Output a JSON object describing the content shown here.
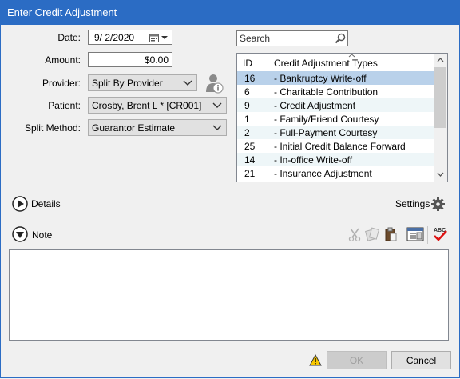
{
  "window": {
    "title": "Enter Credit Adjustment"
  },
  "form": {
    "date_label": "Date:",
    "date_value": "9/  2/2020",
    "amount_label": "Amount:",
    "amount_value": "$0.00",
    "provider_label": "Provider:",
    "provider_value": "Split By Provider",
    "patient_label": "Patient:",
    "patient_value": "Crosby, Brent L *  [CR001]",
    "split_label": "Split Method:",
    "split_value": "Guarantor Estimate"
  },
  "search": {
    "placeholder": "Search"
  },
  "types_list": {
    "col_id": "ID",
    "col_name": "Credit Adjustment Types",
    "rows": [
      {
        "id": "16",
        "name": "- Bankruptcy Write-off"
      },
      {
        "id": "6",
        "name": "- Charitable Contribution"
      },
      {
        "id": "9",
        "name": "- Credit Adjustment"
      },
      {
        "id": "1",
        "name": "- Family/Friend Courtesy"
      },
      {
        "id": "2",
        "name": "- Full-Payment Courtesy"
      },
      {
        "id": "25",
        "name": "- Initial Credit Balance Forward"
      },
      {
        "id": "14",
        "name": "- In-office Write-off"
      },
      {
        "id": "21",
        "name": "- Insurance Adjustment"
      }
    ]
  },
  "details": {
    "label": "Details"
  },
  "settings": {
    "label": "Settings"
  },
  "note": {
    "label": "Note",
    "value": ""
  },
  "buttons": {
    "ok": "OK",
    "cancel": "Cancel"
  },
  "colors": {
    "titlebar": "#2b6cc4",
    "selected_row": "#b9d1ea"
  },
  "icons": [
    "calendar-icon",
    "search-icon",
    "provider-info-icon",
    "chevron-down-icon",
    "expand-arrow-icon",
    "gear-icon",
    "cut-icon",
    "copy-icon",
    "paste-icon",
    "insert-template-icon",
    "spellcheck-icon",
    "warning-icon"
  ]
}
